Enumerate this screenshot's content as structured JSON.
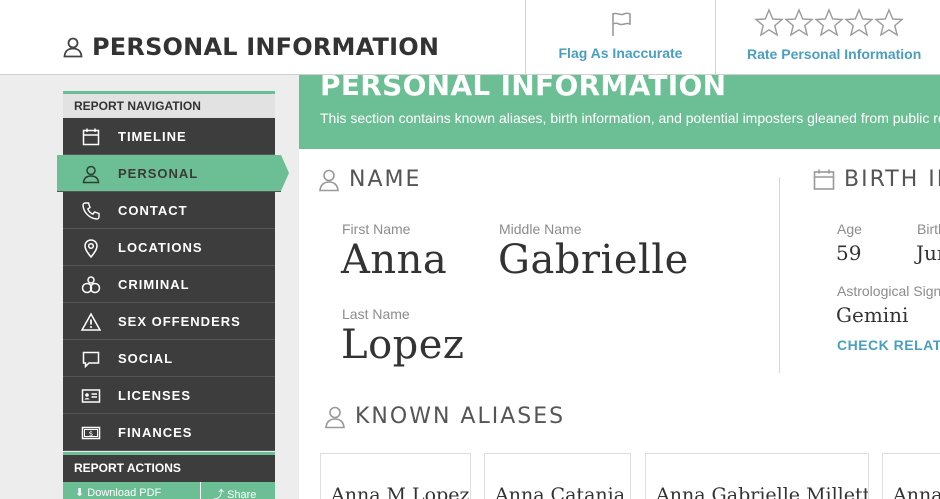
{
  "header": {
    "title": "PERSONAL INFORMATION",
    "flag_label": "Flag As Inaccurate",
    "rate_label": "Rate Personal Information",
    "star_count": 5
  },
  "sidebar": {
    "nav_heading": "REPORT NAVIGATION",
    "items": [
      {
        "label": "TIMELINE",
        "icon": "calendar-icon",
        "active": false
      },
      {
        "label": "PERSONAL",
        "icon": "person-icon",
        "active": true
      },
      {
        "label": "CONTACT",
        "icon": "phone-icon",
        "active": false
      },
      {
        "label": "LOCATIONS",
        "icon": "location-pin-icon",
        "active": false
      },
      {
        "label": "CRIMINAL",
        "icon": "handcuffs-icon",
        "active": false
      },
      {
        "label": "SEX OFFENDERS",
        "icon": "warning-icon",
        "active": false
      },
      {
        "label": "SOCIAL",
        "icon": "chat-bubble-icon",
        "active": false
      },
      {
        "label": "LICENSES",
        "icon": "id-card-icon",
        "active": false
      },
      {
        "label": "FINANCES",
        "icon": "money-icon",
        "active": false
      }
    ],
    "actions_heading": "REPORT ACTIONS",
    "download_label": "Download PDF",
    "share_label": "Share"
  },
  "banner": {
    "title": "PERSONAL INFORMATION",
    "description": "This section contains known aliases, birth information, and potential imposters gleaned from public records."
  },
  "name_section": {
    "title": "NAME",
    "first_name_label": "First Name",
    "first_name": "Anna",
    "middle_name_label": "Middle Name",
    "middle_name": "Gabrielle",
    "last_name_label": "Last Name",
    "last_name": "Lopez"
  },
  "birth_section": {
    "title": "BIRTH INFORMATION",
    "age_label": "Age",
    "age": "59",
    "birthday_label": "Birthday",
    "birthday": "June",
    "astro_label": "Astrological Sign",
    "astro_sign": "Gemini",
    "check_link": "CHECK RELATIONSHIP COMPATIBILITY"
  },
  "aliases_section": {
    "title": "KNOWN ALIASES",
    "aliases": [
      "Anna M Lopez",
      "Anna Catania",
      "Anna Gabrielle Millett",
      "Anna"
    ]
  },
  "colors": {
    "accent_green": "#6cbf94",
    "link_blue": "#4a9ec0",
    "sidebar_dark": "#3d3d3d"
  }
}
